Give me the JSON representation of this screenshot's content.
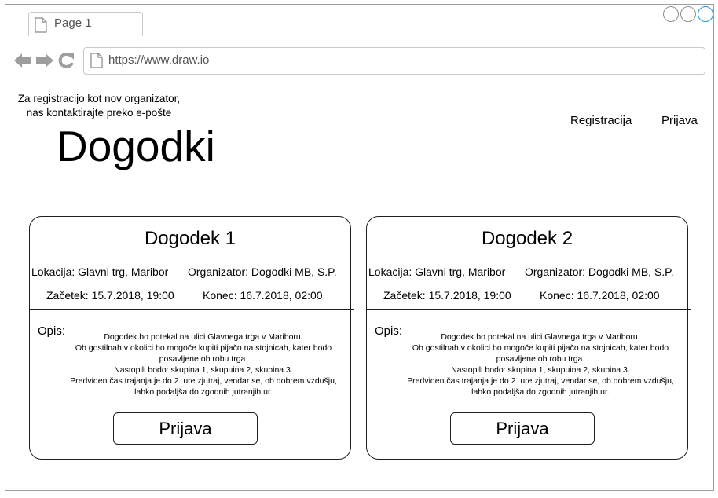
{
  "browser": {
    "tab_label": "Page 1",
    "url": "https://www.draw.io"
  },
  "header": {
    "note": "Za registracijo kot nov organizator,\nnas kontaktirajte preko e-pošte",
    "title": "Dogodki",
    "register_label": "Registracija",
    "login_label": "Prijava"
  },
  "events": [
    {
      "title": "Dogodek 1",
      "location": "Lokacija: Glavni trg, Maribor",
      "organizer": "Organizator: Dogodki MB, S.P.",
      "start": "Začetek: 15.7.2018, 19:00",
      "end": "Konec: 16.7.2018, 02:00",
      "desc_label": "Opis:",
      "description": "Dogodek bo potekal na ulici Glavnega trga v Mariboru.\nOb gostilnah v okolici bo mogoče kupiti pijačo na stojnicah, kater bodo posavljene ob robu trga.\nNastopili bodo: skupina 1, skupuina 2, skupina 3.\nPredviden čas trajanja je do 2. ure zjutraj, vendar se, ob dobrem vzdušju, lahko podaljša do zgodnih jutranjih ur.",
      "button_label": "Prijava"
    },
    {
      "title": "Dogodek 2",
      "location": "Lokacija: Glavni trg, Maribor",
      "organizer": "Organizator: Dogodki MB, S.P.",
      "start": "Začetek: 15.7.2018, 19:00",
      "end": "Konec: 16.7.2018, 02:00",
      "desc_label": "Opis:",
      "description": "Dogodek bo potekal na ulici Glavnega trga v Mariboru.\nOb gostilnah v okolici bo mogoče kupiti pijačo na stojnicah, kater bodo posavljene ob robu trga.\nNastopili bodo: skupina 1, skupuina 2, skupina 3.\nPredviden čas trajanja je do 2. ure zjutraj, vendar se, ob dobrem vzdušju, lahko podaljša do zgodnih jutranjih ur.",
      "button_label": "Prijava"
    }
  ],
  "icons": {
    "back": "arrow-left-icon",
    "forward": "arrow-right-icon",
    "reload": "reload-icon",
    "page": "page-icon"
  },
  "colors": {
    "window_close": "#1a9ad6",
    "nav_icon": "#9e9e9e"
  }
}
